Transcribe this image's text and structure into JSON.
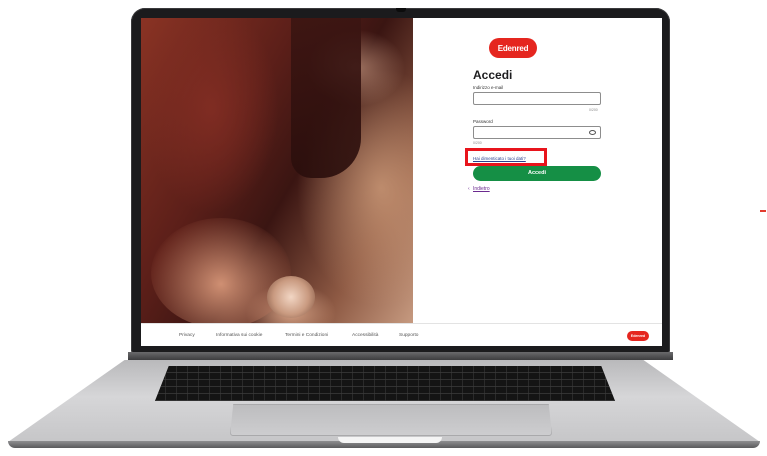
{
  "login": {
    "logo_text": "Edenred",
    "title": "Accedi",
    "email_label": "Indirizzo e-mail",
    "email_value": "",
    "email_counter": "0/200",
    "password_label": "Password",
    "password_value": "",
    "password_counter": "0/200",
    "forgot_link": "Hai dimenticato i tuoi dati?",
    "submit_label": "Accedi",
    "back_label": "Indietro",
    "back_arrow": "‹"
  },
  "footer": {
    "links": [
      "Privacy",
      "Informativa sui cookie",
      "Termini e Condizioni",
      "Accessibilità",
      "Supporto"
    ],
    "logo_text": "Edenred"
  },
  "colors": {
    "brand_red": "#e5261f",
    "primary_green": "#158f45",
    "highlight_red": "#e8141c",
    "link_purple": "#6b2a8f"
  }
}
